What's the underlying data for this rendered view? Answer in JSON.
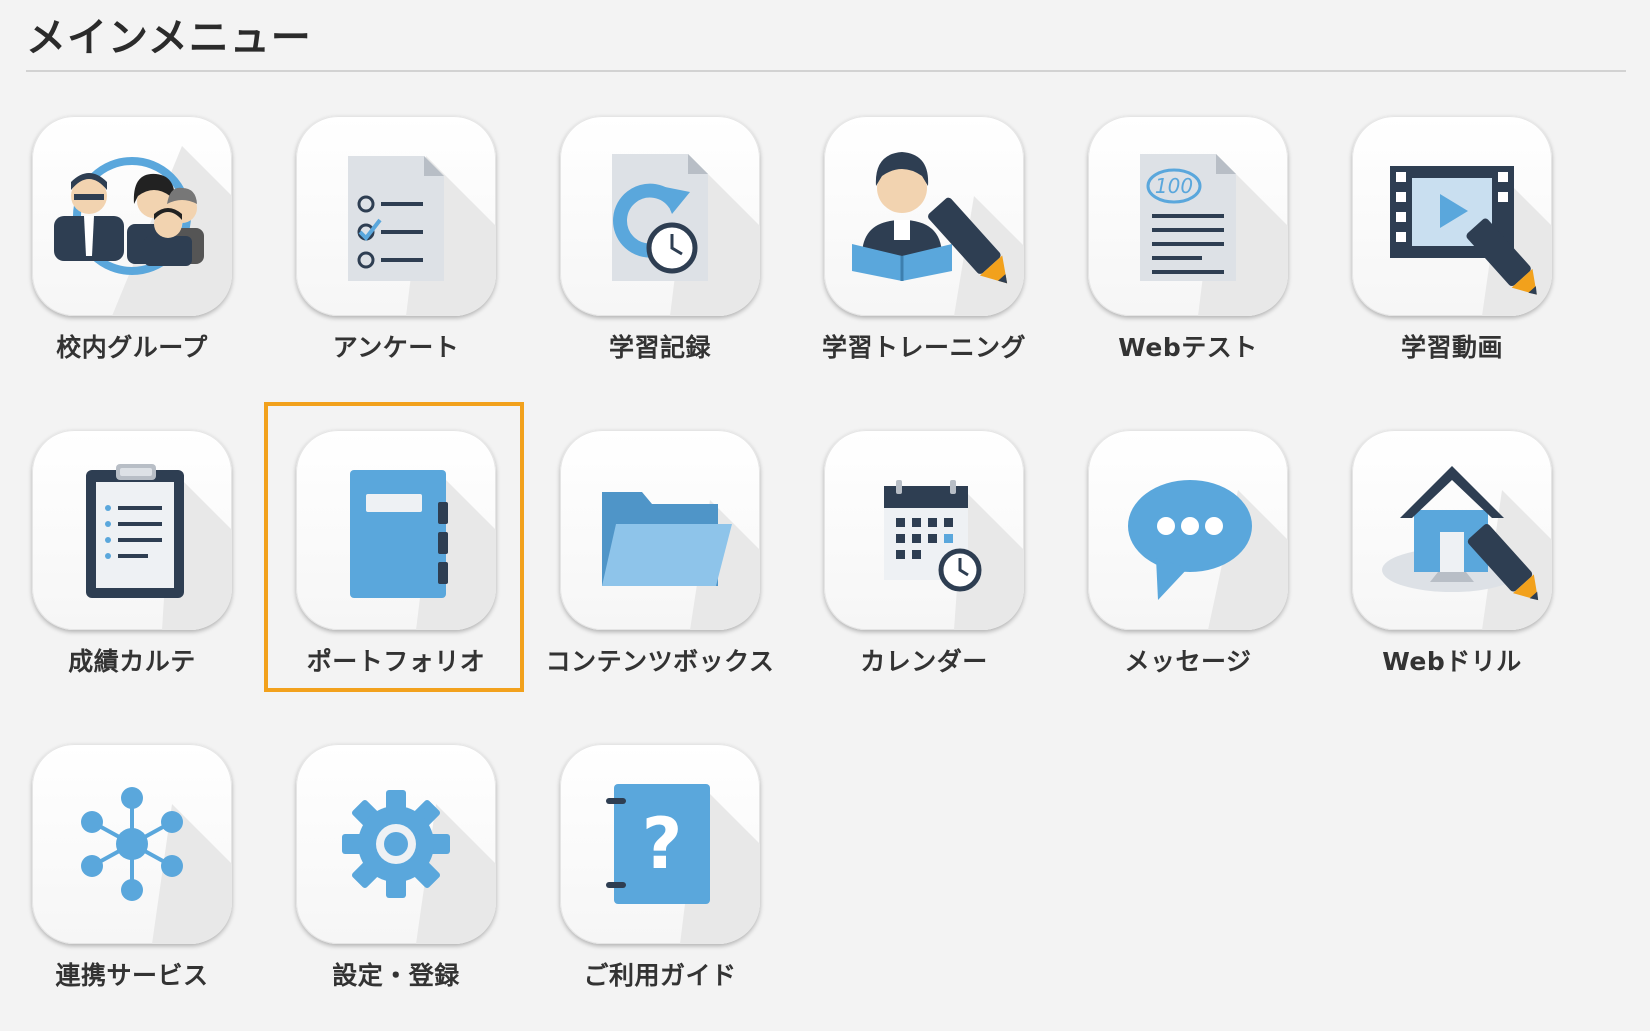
{
  "header": {
    "title": "メインメニュー"
  },
  "menu": {
    "items": [
      {
        "label": "校内グループ",
        "icon": "school-group-icon"
      },
      {
        "label": "アンケート",
        "icon": "survey-checklist-icon"
      },
      {
        "label": "学習記録",
        "icon": "study-record-icon"
      },
      {
        "label": "学習トレーニング",
        "icon": "study-training-icon"
      },
      {
        "label": "Webテスト",
        "icon": "web-test-icon"
      },
      {
        "label": "学習動画",
        "icon": "study-video-icon"
      },
      {
        "label": "成績カルテ",
        "icon": "grade-clipboard-icon"
      },
      {
        "label": "ポートフォリオ",
        "icon": "portfolio-notebook-icon",
        "selected": true
      },
      {
        "label": "コンテンツボックス",
        "icon": "content-folder-icon"
      },
      {
        "label": "カレンダー",
        "icon": "calendar-icon"
      },
      {
        "label": "メッセージ",
        "icon": "message-bubble-icon"
      },
      {
        "label": "Webドリル",
        "icon": "web-drill-icon"
      },
      {
        "label": "連携サービス",
        "icon": "linked-services-icon"
      },
      {
        "label": "設定・登録",
        "icon": "settings-gear-icon"
      },
      {
        "label": "ご利用ガイド",
        "icon": "user-guide-icon"
      }
    ]
  },
  "colors": {
    "accent_selected": "#f2a11c",
    "icon_blue": "#5aa7dc",
    "icon_navy": "#2e3e52",
    "icon_gray": "#dde1e6"
  }
}
